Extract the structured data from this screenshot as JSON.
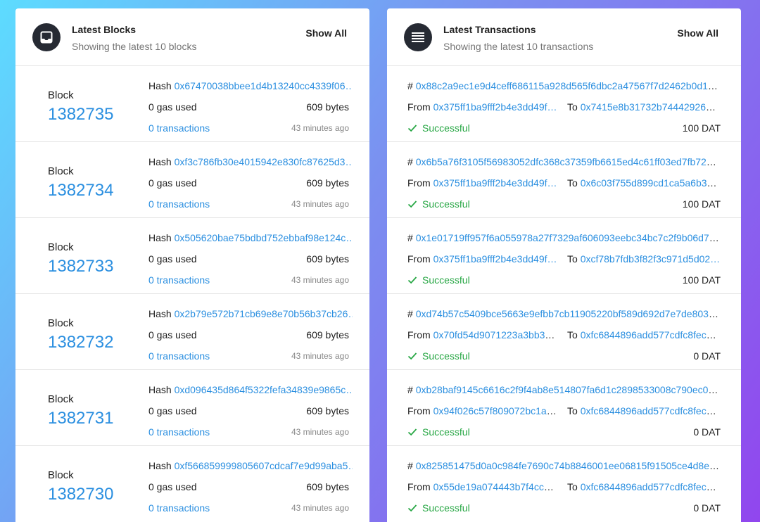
{
  "blocks_panel": {
    "title": "Latest Blocks",
    "subtitle": "Showing the latest 10 blocks",
    "show_all": "Show All",
    "icon": "inbox-icon",
    "block_label": "Block",
    "hash_label": "Hash",
    "items": [
      {
        "number": "1382735",
        "hash": "0x67470038bbee1d4b13240cc4339f06…",
        "gas": "0 gas used",
        "bytes": "609 bytes",
        "transactions": "0 transactions",
        "age": "43 minutes ago"
      },
      {
        "number": "1382734",
        "hash": "0xf3c786fb30e4015942e830fc87625d3…",
        "gas": "0 gas used",
        "bytes": "609 bytes",
        "transactions": "0 transactions",
        "age": "43 minutes ago"
      },
      {
        "number": "1382733",
        "hash": "0x505620bae75bdbd752ebbaf98e124c…",
        "gas": "0 gas used",
        "bytes": "609 bytes",
        "transactions": "0 transactions",
        "age": "43 minutes ago"
      },
      {
        "number": "1382732",
        "hash": "0x2b79e572b71cb69e8e70b56b37cb26…",
        "gas": "0 gas used",
        "bytes": "609 bytes",
        "transactions": "0 transactions",
        "age": "43 minutes ago"
      },
      {
        "number": "1382731",
        "hash": "0xd096435d864f5322fefa34839e9865c…",
        "gas": "0 gas used",
        "bytes": "609 bytes",
        "transactions": "0 transactions",
        "age": "43 minutes ago"
      },
      {
        "number": "1382730",
        "hash": "0xf566859999805607cdcaf7e9d99aba5…",
        "gas": "0 gas used",
        "bytes": "609 bytes",
        "transactions": "0 transactions",
        "age": "43 minutes ago"
      }
    ]
  },
  "tx_panel": {
    "title": "Latest Transactions",
    "subtitle": "Showing the latest 10 transactions",
    "show_all": "Show All",
    "icon": "list-icon",
    "hash_prefix": "#",
    "from_label": "From",
    "to_label": "To",
    "colors": {
      "success": "#28a745",
      "link": "#2b8fe0"
    },
    "items": [
      {
        "hash": "0x88c2a9ec1e9d4ceff686115a928d565f6dbc2a47567f7d2462b0d1b…",
        "from": "0x375ff1ba9fff2b4e3dd49f…",
        "to": "0x7415e8b31732b744429267…",
        "status": "Successful",
        "value": "100 DAT"
      },
      {
        "hash": "0x6b5a76f3105f56983052dfc368c37359fb6615ed4c61ff03ed7fb72e…",
        "from": "0x375ff1ba9fff2b4e3dd49f…",
        "to": "0x6c03f755d899cd1ca5a6b37…",
        "status": "Successful",
        "value": "100 DAT"
      },
      {
        "hash": "0x1e01719ff957f6a055978a27f7329af606093eebc34bc7c2f9b06d73…",
        "from": "0x375ff1ba9fff2b4e3dd49f…",
        "to": "0xcf78b7fdb3f82f3c971d5d02…",
        "status": "Successful",
        "value": "100 DAT"
      },
      {
        "hash": "0xd74b57c5409bce5663e9efbb7cb11905220bf589d692d7e7de803b…",
        "from": "0x70fd54d9071223a3bb31…",
        "to": "0xfc6844896add577cdfc8fec3…",
        "status": "Successful",
        "value": "0 DAT"
      },
      {
        "hash": "0xb28baf9145c6616c2f9f4ab8e514807fa6d1c2898533008c790ec05…",
        "from": "0x94f026c57f809072bc1ac…",
        "to": "0xfc6844896add577cdfc8fec3…",
        "status": "Successful",
        "value": "0 DAT"
      },
      {
        "hash": "0x825851475d0a0c984fe7690c74b8846001ee06815f91505ce4d8e0…",
        "from": "0x55de19a074443b7f4cced…",
        "to": "0xfc6844896add577cdfc8fec3…",
        "status": "Successful",
        "value": "0 DAT"
      }
    ]
  }
}
